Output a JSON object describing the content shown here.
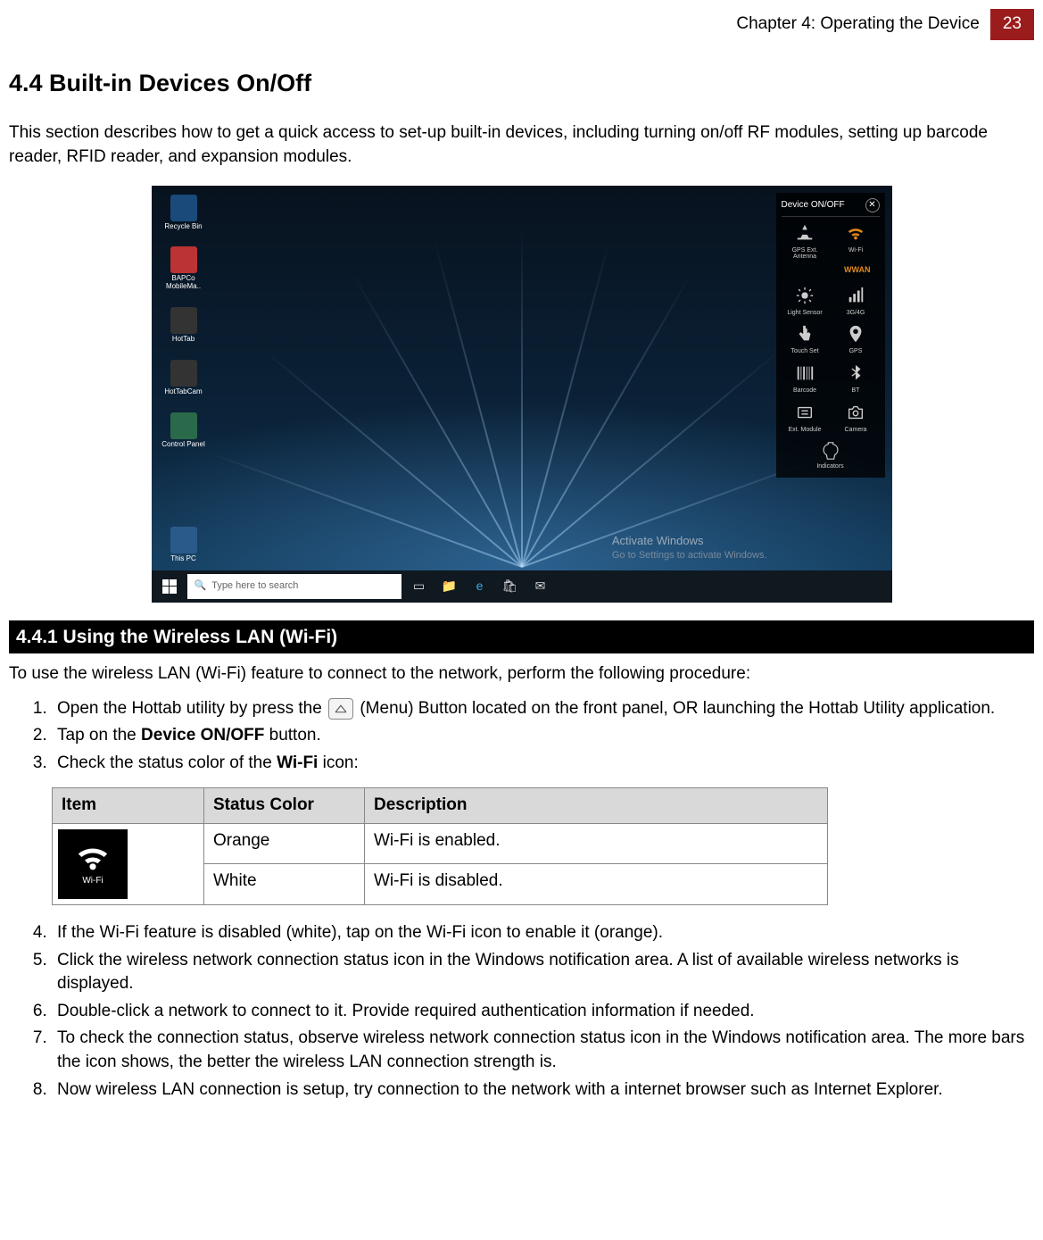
{
  "header": {
    "chapter": "Chapter 4: Operating the Device",
    "page": "23"
  },
  "section": {
    "number_title": "4.4 Built-in Devices On/Off",
    "intro": "This section describes how to get a quick access to set-up built-in devices, including turning on/off RF modules, setting up barcode reader, RFID reader, and expansion modules."
  },
  "screenshot": {
    "desktop_icons": [
      "Recycle Bin",
      "BAPCo MobileMa..",
      "HotTab",
      "HotTabCam",
      "Control Panel",
      "This PC"
    ],
    "search_placeholder": "Type here to search",
    "device_panel": {
      "title": "Device ON/OFF",
      "wwan_label": "WWAN",
      "items": [
        {
          "label": "GPS Ext. Antenna",
          "icon": "gps-antenna"
        },
        {
          "label": "Wi-Fi",
          "icon": "wifi",
          "orange": true
        },
        {
          "label": "Light Sensor",
          "icon": "light-sensor"
        },
        {
          "label": "3G/4G",
          "icon": "cell"
        },
        {
          "label": "Touch Set",
          "icon": "touch"
        },
        {
          "label": "GPS",
          "icon": "gps"
        },
        {
          "label": "Barcode",
          "icon": "barcode"
        },
        {
          "label": "BT",
          "icon": "bt"
        },
        {
          "label": "Ext. Module",
          "icon": "ext"
        },
        {
          "label": "Camera",
          "icon": "camera"
        }
      ],
      "indicators_label": "Indicators"
    },
    "activate": {
      "title": "Activate Windows",
      "sub": "Go to Settings to activate Windows."
    }
  },
  "subsection": {
    "bar": "4.4.1 Using the Wireless LAN (Wi-Fi)",
    "intro": "To use the wireless LAN (Wi-Fi) feature to connect to the network, perform the following procedure:",
    "steps_1_3": {
      "s1a": "Open the Hottab utility by press the ",
      "s1b": " (Menu) Button located on the front panel, OR launching the Hottab Utility application.",
      "s2a": "Tap on the ",
      "s2b_bold": "Device ON/OFF",
      "s2c": " button.",
      "s3a": "Check the status color of the ",
      "s3b_bold": "Wi-Fi",
      "s3c": " icon:"
    },
    "table": {
      "headers": {
        "item": "Item",
        "status": "Status Color",
        "desc": "Description"
      },
      "rows": [
        {
          "status": "Orange",
          "desc": "Wi-Fi is enabled."
        },
        {
          "status": "White",
          "desc": "Wi-Fi is disabled."
        }
      ],
      "wifi_label": "Wi-Fi"
    },
    "steps_4_8": [
      "If the Wi-Fi feature is disabled (white), tap on the Wi-Fi icon to enable it (orange).",
      "Click the wireless network connection status icon in the Windows notification area. A list of available wireless networks is displayed.",
      "Double-click a network to connect to it. Provide required authentication information if needed.",
      "To check the connection status, observe wireless network connection status icon in the Windows notification area. The more bars the icon shows, the better the wireless LAN connection strength is.",
      "Now wireless LAN connection is setup, try connection to the network with a internet browser such as Internet Explorer."
    ]
  }
}
